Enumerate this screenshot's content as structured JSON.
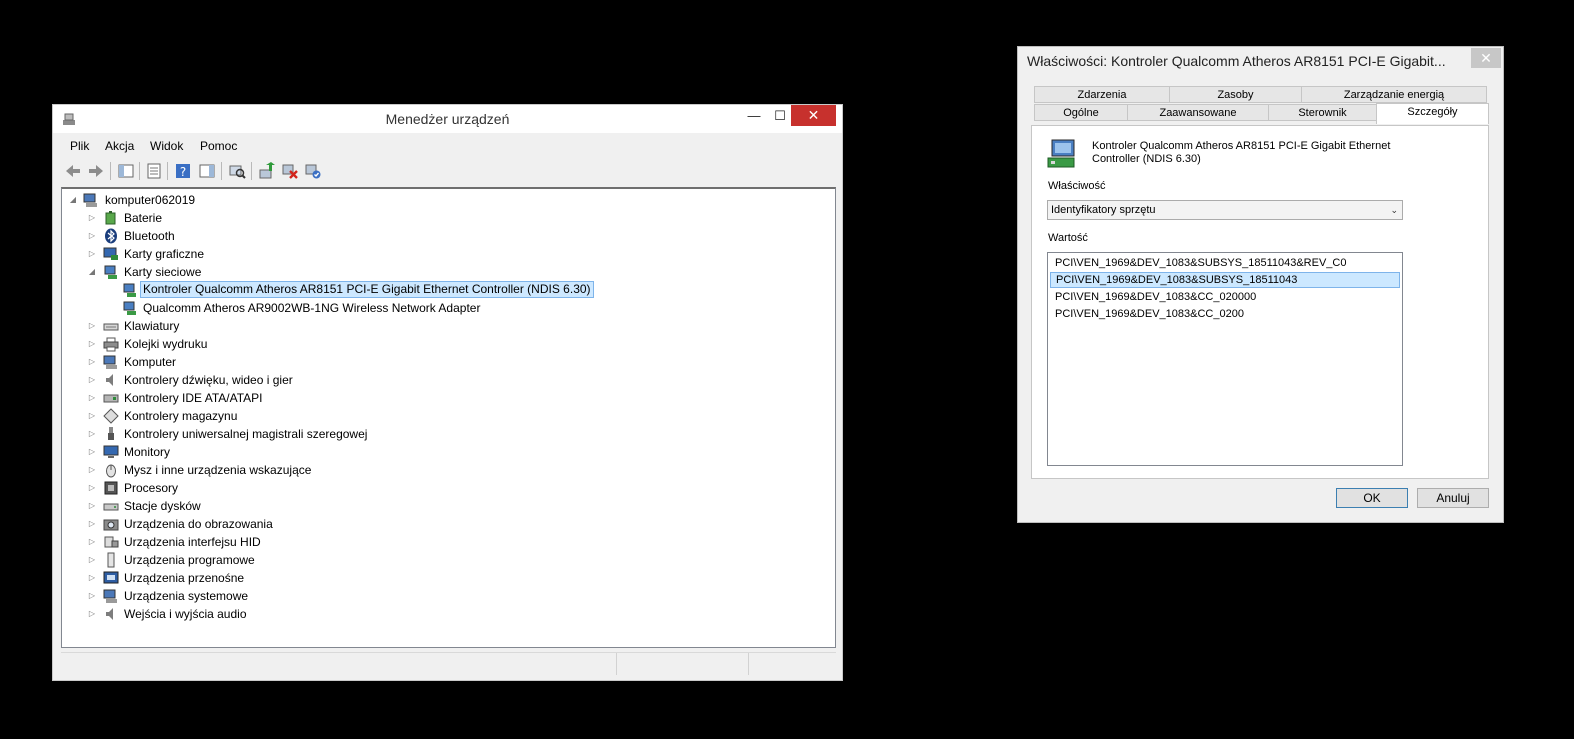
{
  "device_manager": {
    "title": "Menedżer urządzeń",
    "controls": {
      "minimize": "—",
      "maximize": "☐",
      "close": "✕"
    },
    "menu": [
      "Plik",
      "Akcja",
      "Widok",
      "Pomoc"
    ],
    "tree": {
      "root": "komputer062019",
      "categories": [
        {
          "label": "Baterie",
          "icon": "battery-icon"
        },
        {
          "label": "Bluetooth",
          "icon": "bluetooth-icon"
        },
        {
          "label": "Karty graficzne",
          "icon": "display-adapter-icon"
        },
        {
          "label": "Karty sieciowe",
          "icon": "network-adapter-icon",
          "expanded": true,
          "children": [
            {
              "label": "Kontroler Qualcomm Atheros AR8151 PCI-E Gigabit Ethernet Controller (NDIS 6.30)",
              "selected": true
            },
            {
              "label": "Qualcomm Atheros AR9002WB-1NG Wireless Network Adapter"
            }
          ]
        },
        {
          "label": "Klawiatury",
          "icon": "keyboard-icon"
        },
        {
          "label": "Kolejki wydruku",
          "icon": "printer-icon"
        },
        {
          "label": "Komputer",
          "icon": "computer-icon"
        },
        {
          "label": "Kontrolery dźwięku, wideo i gier",
          "icon": "speaker-icon"
        },
        {
          "label": "Kontrolery IDE ATA/ATAPI",
          "icon": "ide-icon"
        },
        {
          "label": "Kontrolery magazynu",
          "icon": "storage-icon"
        },
        {
          "label": "Kontrolery uniwersalnej magistrali szeregowej",
          "icon": "usb-icon"
        },
        {
          "label": "Monitory",
          "icon": "monitor-icon"
        },
        {
          "label": "Mysz i inne urządzenia wskazujące",
          "icon": "mouse-icon"
        },
        {
          "label": "Procesory",
          "icon": "processor-icon"
        },
        {
          "label": "Stacje dysków",
          "icon": "disk-drive-icon"
        },
        {
          "label": "Urządzenia do obrazowania",
          "icon": "camera-icon"
        },
        {
          "label": "Urządzenia interfejsu HID",
          "icon": "hid-icon"
        },
        {
          "label": "Urządzenia programowe",
          "icon": "software-device-icon"
        },
        {
          "label": "Urządzenia przenośne",
          "icon": "portable-device-icon"
        },
        {
          "label": "Urządzenia systemowe",
          "icon": "system-device-icon"
        },
        {
          "label": "Wejścia i wyjścia audio",
          "icon": "audio-io-icon"
        }
      ]
    }
  },
  "properties_dialog": {
    "title": "Właściwości: Kontroler Qualcomm Atheros AR8151 PCI-E Gigabit...",
    "close": "✕",
    "tabs_top": [
      "Zdarzenia",
      "Zasoby",
      "Zarządzanie energią"
    ],
    "tabs_bottom": [
      "Ogólne",
      "Zaawansowane",
      "Sterownik",
      "Szczegóły"
    ],
    "active_tab": "Szczegóły",
    "device_name": "Kontroler Qualcomm Atheros AR8151 PCI-E Gigabit Ethernet Controller (NDIS 6.30)",
    "property_label": "Właściwość",
    "property_value": "Identyfikatory sprzętu",
    "value_label": "Wartość",
    "values": [
      "PCI\\VEN_1969&DEV_1083&SUBSYS_18511043&REV_C0",
      "PCI\\VEN_1969&DEV_1083&SUBSYS_18511043",
      "PCI\\VEN_1969&DEV_1083&CC_020000",
      "PCI\\VEN_1969&DEV_1083&CC_0200"
    ],
    "selected_value_index": 1,
    "ok_label": "OK",
    "cancel_label": "Anuluj"
  }
}
